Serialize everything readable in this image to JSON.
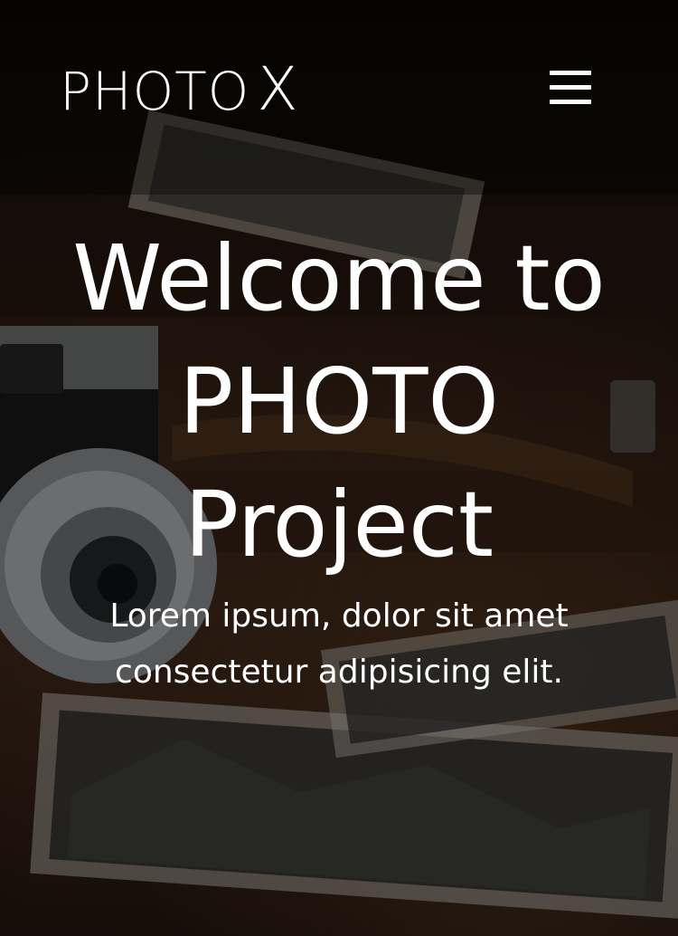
{
  "navbar": {
    "logo_text": "PHOTO",
    "logo_mark": "X",
    "menu_icon": "hamburger-menu-icon"
  },
  "hero": {
    "headline": "Welcome to PHOTO Project",
    "subtitle": "Lorem ipsum, dolor sit amet consectetur adipisicing elit."
  },
  "colors": {
    "text": "#ffffff",
    "overlay": "#000000",
    "background": "#2a1a10"
  }
}
